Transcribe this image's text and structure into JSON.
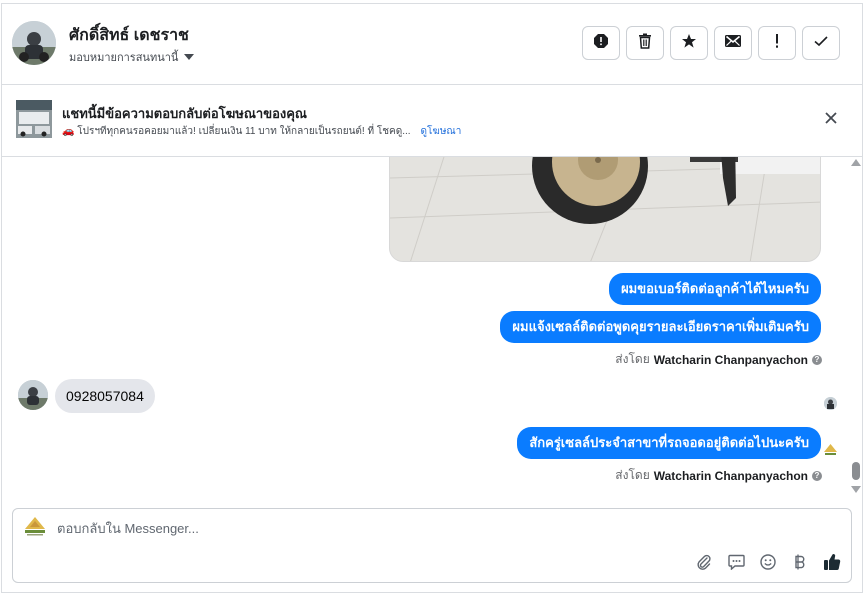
{
  "header": {
    "contact_name": "ศักดิ์สิทธ์ เดชราช",
    "assign_label": "มอบหมายการสนทนานี้",
    "actions": [
      {
        "name": "report-spam-icon"
      },
      {
        "name": "trash-icon"
      },
      {
        "name": "star-icon"
      },
      {
        "name": "mail-icon"
      },
      {
        "name": "exclamation-icon"
      },
      {
        "name": "check-icon"
      }
    ]
  },
  "ad_banner": {
    "title": "แชทนี้มีข้อความตอบกลับต่อโฆษณาของคุณ",
    "subtitle": "🚗 โปรฯทีทุกคนรอคอยมาแล้ว! เปลี่ยนเงิน 11 บาท ให้กลายเป็นรถยนต์! ที่ โชคดู...",
    "link": "ดูโฆษณา"
  },
  "messages": {
    "out1": "ผมขอเบอร์ติดต่อลูกค้าได้ไหมครับ",
    "out2": "ผมแจ้งเซลล์ติดต่อพูดคุยรายละเอียดราคาเพิ่มเติมครับ",
    "sent_by_prefix": "ส่งโดย",
    "sent_by_name": "Watcharin Chanpanyachon",
    "in1": "0928057084",
    "out3": "สักครู่เซลล์ประจำสาขาที่รถจอดอยู่ติดต่อไปนะครับ",
    "sent_by_prefix_2": "ส่งโดย",
    "sent_by_name_2": "Watcharin Chanpanyachon"
  },
  "composer": {
    "placeholder": "ตอบกลับใน Messenger...",
    "tools": [
      "attachment-icon",
      "saved-reply-icon",
      "emoji-icon",
      "baht-payment-icon",
      "like-icon"
    ]
  },
  "colors": {
    "accent": "#0a7cff",
    "incoming_bubble": "#e4e6eb",
    "link": "#216fdb"
  }
}
